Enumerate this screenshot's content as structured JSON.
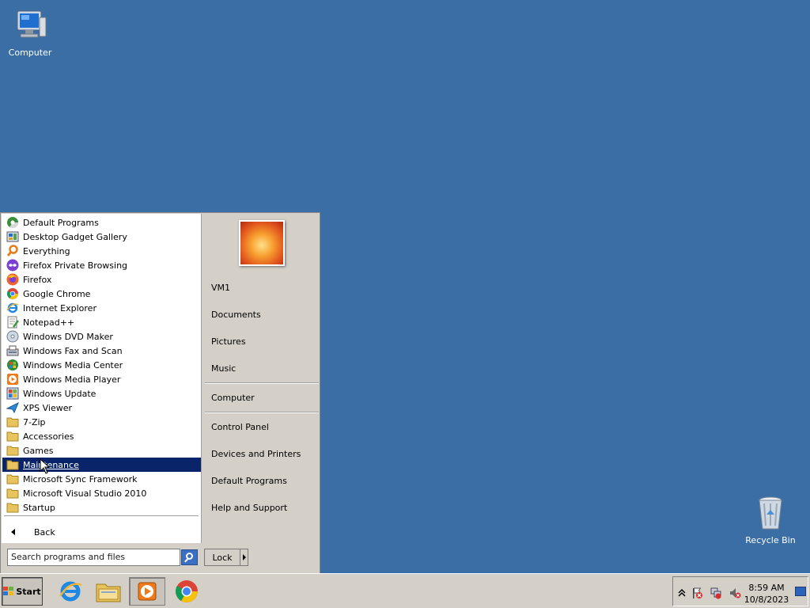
{
  "desktop": {
    "icons": [
      {
        "label": "Computer",
        "icon": "computer-icon"
      },
      {
        "label": "Recycle Bin",
        "icon": "recycle-bin-icon"
      }
    ]
  },
  "start_menu": {
    "programs": [
      {
        "label": "Default Programs",
        "icon": "default-programs-icon"
      },
      {
        "label": "Desktop Gadget Gallery",
        "icon": "gadget-gallery-icon"
      },
      {
        "label": "Everything",
        "icon": "everything-search-icon"
      },
      {
        "label": "Firefox Private Browsing",
        "icon": "firefox-private-icon"
      },
      {
        "label": "Firefox",
        "icon": "firefox-icon"
      },
      {
        "label": "Google Chrome",
        "icon": "chrome-icon"
      },
      {
        "label": "Internet Explorer",
        "icon": "internet-explorer-icon"
      },
      {
        "label": "Notepad++",
        "icon": "notepad-plus-plus-icon"
      },
      {
        "label": "Windows DVD Maker",
        "icon": "dvd-maker-icon"
      },
      {
        "label": "Windows Fax and Scan",
        "icon": "fax-scan-icon"
      },
      {
        "label": "Windows Media Center",
        "icon": "media-center-icon"
      },
      {
        "label": "Windows Media Player",
        "icon": "media-player-icon"
      },
      {
        "label": "Windows Update",
        "icon": "windows-update-icon"
      },
      {
        "label": "XPS Viewer",
        "icon": "xps-viewer-icon"
      },
      {
        "label": "7-Zip",
        "icon": "folder-icon"
      },
      {
        "label": "Accessories",
        "icon": "folder-icon"
      },
      {
        "label": "Games",
        "icon": "folder-icon"
      },
      {
        "label": "Maintenance",
        "icon": "folder-icon",
        "selected": true
      },
      {
        "label": "Microsoft Sync Framework",
        "icon": "folder-icon"
      },
      {
        "label": "Microsoft Visual Studio 2010",
        "icon": "folder-icon"
      },
      {
        "label": "Startup",
        "icon": "folder-icon"
      }
    ],
    "back_label": "Back",
    "search_placeholder": "Search programs and files",
    "right_items": {
      "user": "VM1",
      "documents": "Documents",
      "pictures": "Pictures",
      "music": "Music",
      "computer": "Computer",
      "control_panel": "Control Panel",
      "devices_printers": "Devices and Printers",
      "default_programs": "Default Programs",
      "help_support": "Help and Support"
    },
    "lock_label": "Lock"
  },
  "taskbar": {
    "start_label": "Start",
    "pinned": [
      {
        "name": "internet-explorer",
        "icon": "internet-explorer-icon"
      },
      {
        "name": "file-explorer",
        "icon": "folder-explorer-icon"
      },
      {
        "name": "media-player",
        "icon": "media-player-icon",
        "active": true
      },
      {
        "name": "chrome",
        "icon": "chrome-icon"
      }
    ],
    "clock_time": "8:59 AM",
    "clock_date": "10/8/2023"
  },
  "colors": {
    "desktop": "#3a6ea5",
    "selection": "#0a246a",
    "chrome_face": "#d4d0c8"
  }
}
